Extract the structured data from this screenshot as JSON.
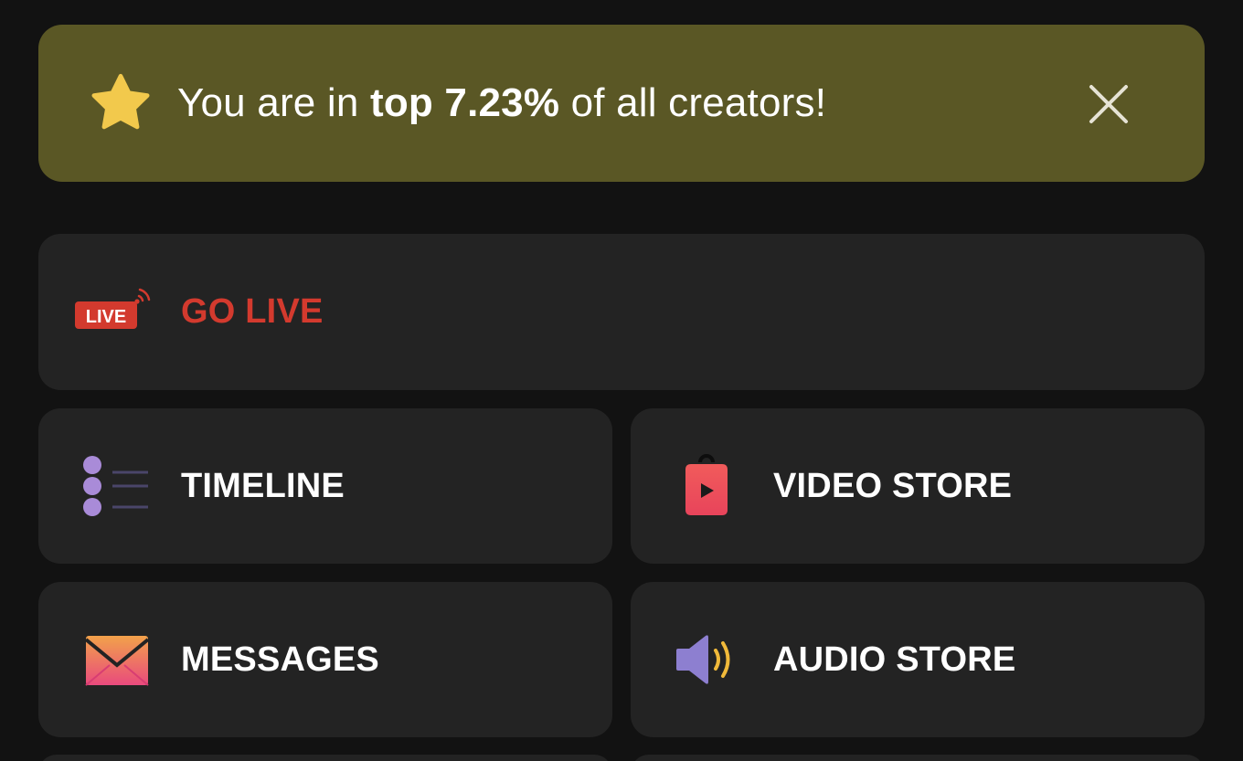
{
  "banner": {
    "prefix": "You are in ",
    "highlight": "top 7.23%",
    "suffix": " of all creators!",
    "star_color": "#f2c94c",
    "background": "#5a5725",
    "icon": "star-icon",
    "close_icon": "close-icon"
  },
  "menu": {
    "go_live": {
      "label": "GO LIVE",
      "icon": "live-broadcast-icon",
      "color": "#d33a2e"
    },
    "timeline": {
      "label": "TIMELINE",
      "icon": "timeline-list-icon"
    },
    "video_store": {
      "label": "VIDEO STORE",
      "icon": "video-bag-icon"
    },
    "messages": {
      "label": "MESSAGES",
      "icon": "envelope-icon"
    },
    "audio_store": {
      "label": "AUDIO STORE",
      "icon": "speaker-icon"
    }
  }
}
